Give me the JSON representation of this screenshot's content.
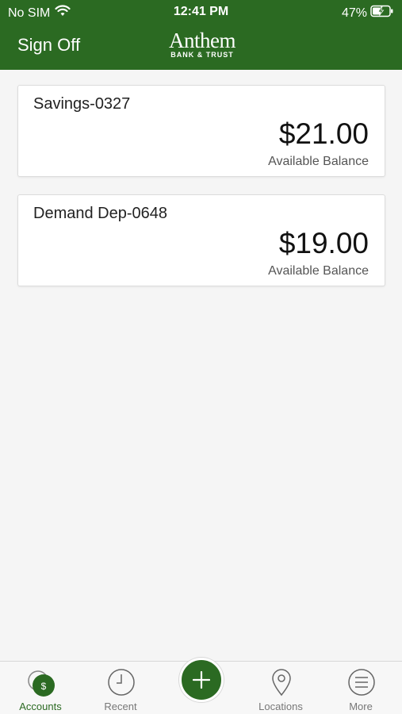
{
  "status_bar": {
    "carrier": "No SIM",
    "time": "12:41 PM",
    "battery": "47%"
  },
  "header": {
    "sign_off_label": "Sign Off",
    "logo_name": "Anthem",
    "logo_sub": "BANK & TRUST"
  },
  "accounts": [
    {
      "name": "Savings-0327",
      "balance": "$21.00",
      "balance_label": "Available Balance"
    },
    {
      "name": "Demand Dep-0648",
      "balance": "$19.00",
      "balance_label": "Available Balance"
    }
  ],
  "tabs": [
    {
      "label": "Accounts",
      "icon": "accounts-dollar-icon"
    },
    {
      "label": "Recent",
      "icon": "clock-icon"
    },
    {
      "label": "Locations",
      "icon": "location-pin-icon"
    },
    {
      "label": "More",
      "icon": "menu-icon"
    }
  ],
  "fab": {
    "icon": "plus-icon"
  },
  "colors": {
    "brand": "#2b6a22",
    "background": "#f5f5f5"
  }
}
